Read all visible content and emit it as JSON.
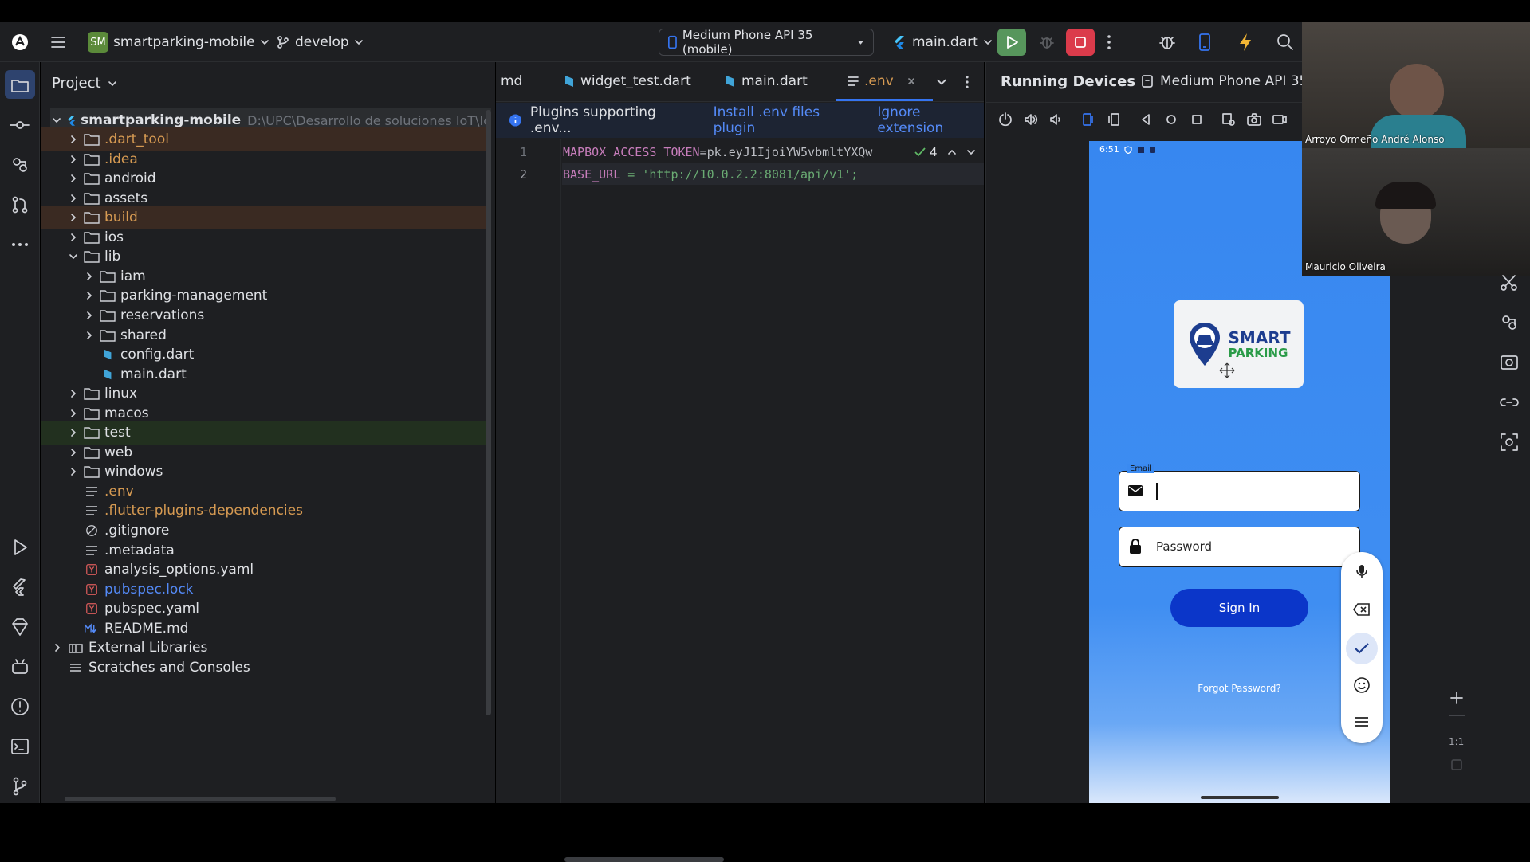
{
  "toolbar": {
    "project_badge": "SM",
    "project_name": "smartparking-mobile",
    "branch": "develop",
    "device": "Medium Phone API 35 (mobile)",
    "run_config": "main.dart"
  },
  "project_panel": {
    "title": "Project",
    "root": {
      "name": "smartparking-mobile",
      "path": "D:\\UPC\\Desarrollo de soluciones IoT\\Io"
    },
    "items": [
      {
        "label": ".dart_tool",
        "color": "#d69a52"
      },
      {
        "label": ".idea",
        "color": "#d69a52"
      },
      {
        "label": "android",
        "color": "#dfe1e5"
      },
      {
        "label": "assets",
        "color": "#dfe1e5"
      },
      {
        "label": "build",
        "color": "#d69a52"
      },
      {
        "label": "ios",
        "color": "#dfe1e5"
      },
      {
        "label": "lib",
        "color": "#dfe1e5"
      },
      {
        "label": "iam",
        "color": "#dfe1e5"
      },
      {
        "label": "parking-management",
        "color": "#dfe1e5"
      },
      {
        "label": "reservations",
        "color": "#dfe1e5"
      },
      {
        "label": "shared",
        "color": "#dfe1e5"
      },
      {
        "label": "config.dart",
        "color": "#dfe1e5"
      },
      {
        "label": "main.dart",
        "color": "#dfe1e5"
      },
      {
        "label": "linux",
        "color": "#dfe1e5"
      },
      {
        "label": "macos",
        "color": "#dfe1e5"
      },
      {
        "label": "test",
        "color": "#dfe1e5"
      },
      {
        "label": "web",
        "color": "#dfe1e5"
      },
      {
        "label": "windows",
        "color": "#dfe1e5"
      },
      {
        "label": ".env",
        "color": "#d69a52"
      },
      {
        "label": ".flutter-plugins-dependencies",
        "color": "#d69a52"
      },
      {
        "label": ".gitignore",
        "color": "#dfe1e5"
      },
      {
        "label": ".metadata",
        "color": "#dfe1e5"
      },
      {
        "label": "analysis_options.yaml",
        "color": "#dfe1e5"
      },
      {
        "label": "pubspec.lock",
        "color": "#548af7"
      },
      {
        "label": "pubspec.yaml",
        "color": "#dfe1e5"
      },
      {
        "label": "README.md",
        "color": "#dfe1e5"
      },
      {
        "label": "External Libraries",
        "color": "#dfe1e5"
      },
      {
        "label": "Scratches and Consoles",
        "color": "#dfe1e5"
      }
    ]
  },
  "editor": {
    "tabs": [
      "md",
      "widget_test.dart",
      "main.dart",
      ".env"
    ],
    "banner": {
      "text": "Plugins supporting .env...",
      "install": "Install .env files plugin",
      "ignore": "Ignore extension"
    },
    "problems_count": "4",
    "lines": [
      {
        "num": "1",
        "key": "MAPBOX_ACCESS_TOKEN",
        "value": "=pk.eyJ1IjoiYW5vbmltYXQw"
      },
      {
        "num": "2",
        "key": "BASE_URL",
        "value": " = 'http://10.0.2.2:8081/api/v1';"
      }
    ]
  },
  "devices_panel": {
    "title": "Running Devices",
    "device_tab": "Medium Phone API 35",
    "status_time": "6:51",
    "logo": {
      "line1": "SMART",
      "line2": "PARKING"
    },
    "email_label": "Email",
    "password_placeholder": "Password",
    "sign_in": "Sign In",
    "forgot": "Forgot Password?",
    "zoom_label": "1:1"
  },
  "video_call": {
    "participant1": "Arroyo Ormeño André Alonso",
    "participant2": "Mauricio Oliveira"
  },
  "colors": {
    "accent": "#3574f0",
    "run_green": "#57965c",
    "stop_red": "#db3b4b",
    "phone_blue": "#3a8af1",
    "button_navy": "#0b36c9"
  }
}
